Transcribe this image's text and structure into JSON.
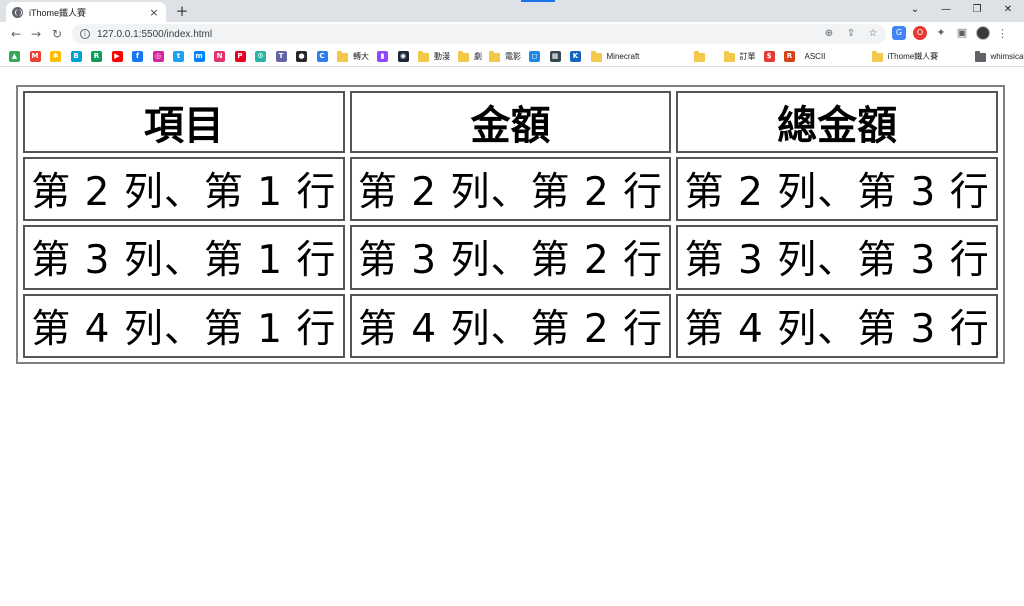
{
  "browser": {
    "tab_title": "iThome鐵人賽",
    "tab_close": "×",
    "new_tab": "+",
    "url": "127.0.0.1:5500/index.html",
    "window_controls": [
      "⌄",
      "—",
      "❐",
      "✕"
    ]
  },
  "bookmarks": [
    {
      "type": "icon",
      "icon": "drive-icon",
      "glyph": "▲",
      "color": "#34a853"
    },
    {
      "type": "icon",
      "icon": "gmail-icon",
      "glyph": "M",
      "color": "#ea4335"
    },
    {
      "type": "icon",
      "icon": "photos-icon",
      "glyph": "✱",
      "color": "#fbbc04"
    },
    {
      "type": "icon",
      "icon": "bilibili-icon",
      "glyph": "B",
      "color": "#00a1d6"
    },
    {
      "type": "icon",
      "icon": "app-icon",
      "glyph": "R",
      "color": "#0f9d58"
    },
    {
      "type": "icon",
      "icon": "youtube-icon",
      "glyph": "▶",
      "color": "#ff0000"
    },
    {
      "type": "icon",
      "icon": "facebook-icon",
      "glyph": "f",
      "color": "#1877f2"
    },
    {
      "type": "icon",
      "icon": "instagram-icon",
      "glyph": "◎",
      "color": "#d6249f"
    },
    {
      "type": "icon",
      "icon": "twitter-icon",
      "glyph": "t",
      "color": "#1da1f2"
    },
    {
      "type": "icon",
      "icon": "messenger-icon",
      "glyph": "m",
      "color": "#0084ff"
    },
    {
      "type": "icon",
      "icon": "app-icon",
      "glyph": "N",
      "color": "#e2336b"
    },
    {
      "type": "icon",
      "icon": "pinterest-icon",
      "glyph": "P",
      "color": "#e60023"
    },
    {
      "type": "icon",
      "icon": "app-icon",
      "glyph": "⚙",
      "color": "#2bb3a5"
    },
    {
      "type": "icon",
      "icon": "teams-icon",
      "glyph": "T",
      "color": "#6264a7"
    },
    {
      "type": "icon",
      "icon": "github-icon",
      "glyph": "●",
      "color": "#24292e"
    },
    {
      "type": "icon",
      "icon": "app-icon",
      "glyph": "C",
      "color": "#2f80ed"
    },
    {
      "type": "folder",
      "label": "轉大"
    },
    {
      "type": "icon",
      "icon": "twitch-icon",
      "glyph": "▮",
      "color": "#9146ff"
    },
    {
      "type": "icon",
      "icon": "steam-icon",
      "glyph": "◉",
      "color": "#1b2838"
    },
    {
      "type": "folder",
      "label": "動漫"
    },
    {
      "type": "folder",
      "label": "劇"
    },
    {
      "type": "folder",
      "label": "電影"
    },
    {
      "type": "icon",
      "icon": "app-icon",
      "glyph": "◻",
      "color": "#1e88e5"
    },
    {
      "type": "icon",
      "icon": "app-icon",
      "glyph": "▦",
      "color": "#37474f"
    },
    {
      "type": "icon",
      "icon": "app-icon",
      "glyph": "K",
      "color": "#1565c0"
    },
    {
      "type": "folder",
      "label": "Minecraft"
    },
    {
      "type": "folder",
      "label": ""
    },
    {
      "type": "folder",
      "label": "訂單"
    },
    {
      "type": "icon",
      "icon": "app-icon",
      "glyph": "$",
      "color": "#e53935"
    },
    {
      "type": "icon",
      "icon": "app-icon",
      "glyph": "R",
      "color": "#d84315"
    },
    {
      "type": "plain",
      "label": "ASCII"
    },
    {
      "type": "folder",
      "label": "iThome鐵人賽"
    },
    {
      "type": "darkfolder",
      "label": "whimsical"
    }
  ],
  "table": {
    "headers": [
      "項目",
      "金額",
      "總金額"
    ],
    "rows": [
      [
        "第 2 列、第 1 行",
        "第 2 列、第 2 行",
        "第 2 列、第 3 行"
      ],
      [
        "第 3 列、第 1 行",
        "第 3 列、第 2 行",
        "第 3 列、第 3 行"
      ],
      [
        "第 4 列、第 1 行",
        "第 4 列、第 2 行",
        "第 4 列、第 3 行"
      ]
    ]
  }
}
